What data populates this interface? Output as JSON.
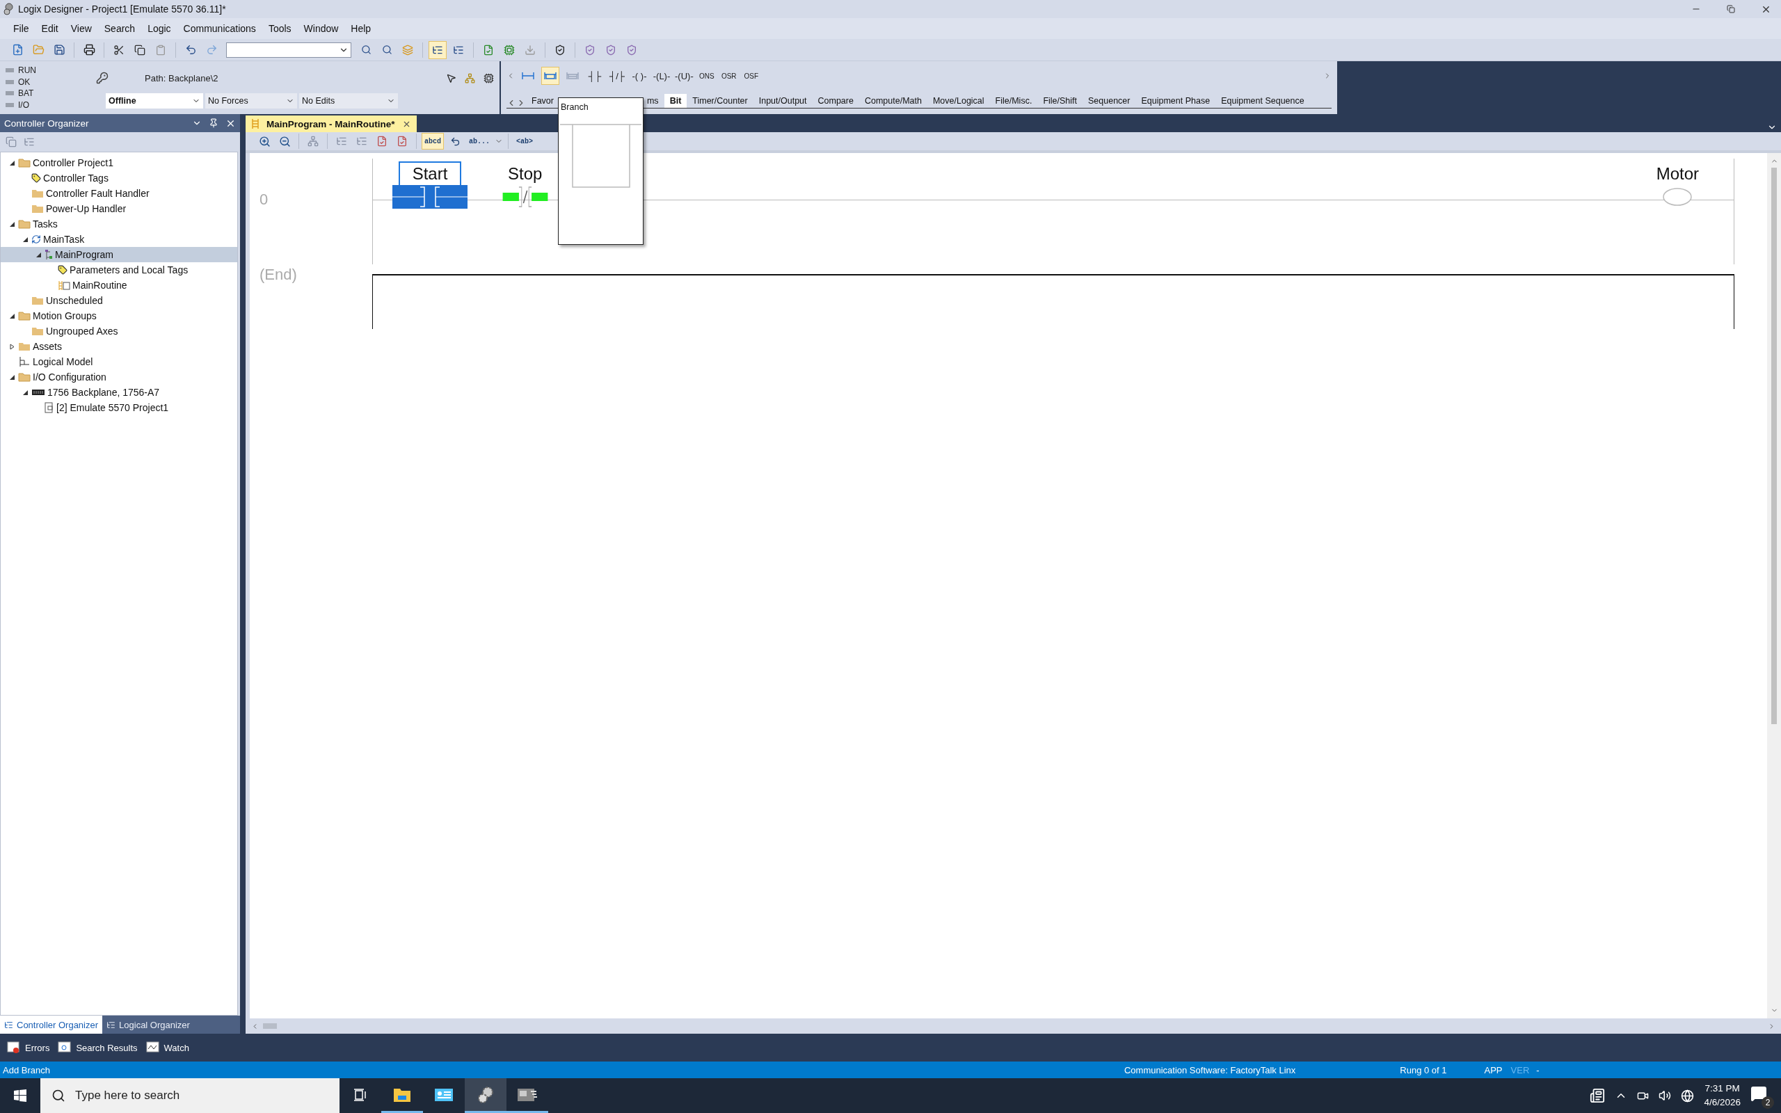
{
  "window": {
    "title": "Logix Designer - Project1 [Emulate 5570 36.11]*"
  },
  "menu": [
    "File",
    "Edit",
    "View",
    "Search",
    "Logic",
    "Communications",
    "Tools",
    "Window",
    "Help"
  ],
  "controller_status": {
    "indicators": [
      {
        "label": "RUN",
        "on": false
      },
      {
        "label": "OK",
        "on": false
      },
      {
        "label": "BAT",
        "on": false
      },
      {
        "label": "I/O",
        "on": false
      }
    ],
    "path": "Path: Backplane\\2",
    "mode": "Offline",
    "forces": "No Forces",
    "edits": "No Edits"
  },
  "instruction_palette": {
    "tools": [
      {
        "kind": "rung",
        "selected": false
      },
      {
        "kind": "branch",
        "selected": true
      },
      {
        "kind": "branch-level",
        "selected": false
      }
    ],
    "instructions": [
      "┤├",
      "┤/├",
      "-( )-",
      "-(L)-",
      "-(U)-",
      "ONS",
      "OSR",
      "OSF"
    ],
    "tabs": [
      {
        "label": "Favor",
        "selected": false
      },
      {
        "label": "ms",
        "selected": false
      },
      {
        "label": "Bit",
        "selected": true
      },
      {
        "label": "Timer/Counter",
        "selected": false
      },
      {
        "label": "Input/Output",
        "selected": false
      },
      {
        "label": "Compare",
        "selected": false
      },
      {
        "label": "Compute/Math",
        "selected": false
      },
      {
        "label": "Move/Logical",
        "selected": false
      },
      {
        "label": "File/Misc.",
        "selected": false
      },
      {
        "label": "File/Shift",
        "selected": false
      },
      {
        "label": "Sequencer",
        "selected": false
      },
      {
        "label": "Equipment Phase",
        "selected": false
      },
      {
        "label": "Equipment Sequence",
        "selected": false
      }
    ]
  },
  "popup": {
    "title": "Branch"
  },
  "organizer": {
    "title": "Controller Organizer",
    "tree": [
      {
        "label": "Controller Project1",
        "kind": "folder-open",
        "expanded": true,
        "selected": false,
        "children": [
          {
            "label": "Controller Tags",
            "kind": "tags",
            "selected": false
          },
          {
            "label": "Controller Fault Handler",
            "kind": "folder",
            "selected": false
          },
          {
            "label": "Power-Up Handler",
            "kind": "folder",
            "selected": false
          }
        ]
      },
      {
        "label": "Tasks",
        "kind": "folder-open",
        "expanded": true,
        "selected": false,
        "children": [
          {
            "label": "MainTask",
            "kind": "task",
            "expanded": true,
            "selected": false,
            "children": [
              {
                "label": "MainProgram",
                "kind": "program",
                "expanded": true,
                "selected": true,
                "children": [
                  {
                    "label": "Parameters and Local Tags",
                    "kind": "tags",
                    "selected": false
                  },
                  {
                    "label": "MainRoutine",
                    "kind": "routine",
                    "selected": false
                  }
                ]
              }
            ]
          },
          {
            "label": "Unscheduled",
            "kind": "folder",
            "selected": false
          }
        ]
      },
      {
        "label": "Motion Groups",
        "kind": "folder-open",
        "expanded": true,
        "selected": false,
        "children": [
          {
            "label": "Ungrouped Axes",
            "kind": "folder",
            "selected": false
          }
        ]
      },
      {
        "label": "Assets",
        "kind": "folder",
        "expanded": false,
        "selected": false
      },
      {
        "label": "Logical Model",
        "kind": "model",
        "selected": false
      },
      {
        "label": "I/O Configuration",
        "kind": "folder-open",
        "expanded": true,
        "selected": false,
        "children": [
          {
            "label": "1756 Backplane, 1756-A7",
            "kind": "backplane",
            "expanded": true,
            "selected": false,
            "children": [
              {
                "label": "[2] Emulate 5570 Project1",
                "kind": "module",
                "selected": false
              }
            ]
          }
        ]
      }
    ],
    "tabs": [
      {
        "label": "Controller Organizer",
        "selected": true
      },
      {
        "label": "Logical Organizer",
        "selected": false
      }
    ]
  },
  "editor": {
    "tab": "MainProgram - MainRoutine*",
    "tools": [
      {
        "label": "abcd",
        "selected": true
      },
      {
        "label": "ab...",
        "selected": false
      },
      {
        "label": "<ab>",
        "selected": false
      }
    ],
    "rungs": [
      {
        "number": "0",
        "instructions": [
          {
            "kind": "xic",
            "tag": "Start",
            "selected": true,
            "energized": false
          },
          {
            "kind": "xio",
            "tag": "Stop",
            "selected": false,
            "energized": true
          },
          {
            "kind": "ote",
            "tag": "Motor",
            "selected": false,
            "energized": false
          }
        ]
      }
    ],
    "end": "(End)"
  },
  "output_tabs": [
    {
      "label": "Errors",
      "kind": "errors"
    },
    {
      "label": "Search Results",
      "kind": "search"
    },
    {
      "label": "Watch",
      "kind": "watch"
    }
  ],
  "status_bar": {
    "message": "Add Branch",
    "communication": "Communication Software: FactoryTalk Linx",
    "rung": "Rung 0 of 1",
    "app": "APP",
    "ver": "VER",
    "dash": "-"
  },
  "taskbar": {
    "search_placeholder": "Type here to search",
    "apps": [
      {
        "kind": "files",
        "running": true,
        "selected": false
      },
      {
        "kind": "dashboard",
        "running": false,
        "selected": false
      },
      {
        "kind": "gears",
        "running": true,
        "selected": true
      },
      {
        "kind": "media",
        "running": true,
        "selected": false
      }
    ],
    "time": "7:31 PM",
    "date": "4/6/2026",
    "notifications": "2"
  }
}
